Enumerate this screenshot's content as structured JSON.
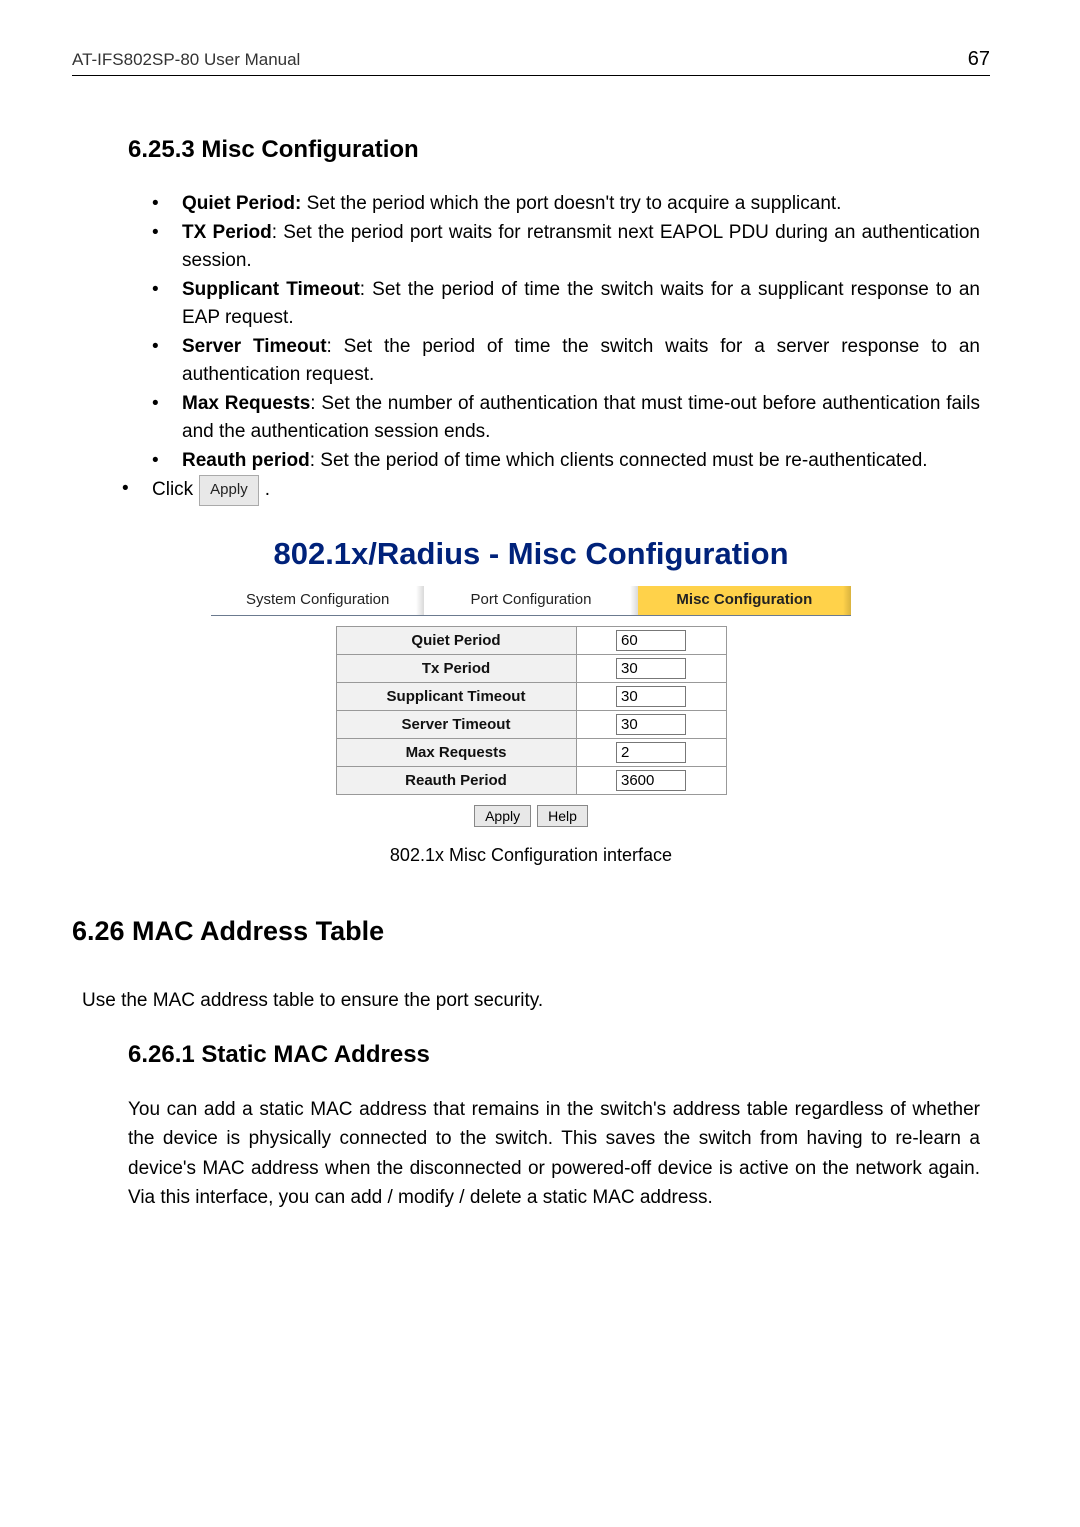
{
  "header": {
    "left": "AT-IFS802SP-80 User Manual",
    "right": "67"
  },
  "section_6_25_3": {
    "title": "6.25.3  Misc Configuration",
    "bullets": [
      {
        "bold": "Quiet Period:",
        "rest": " Set the period which the port doesn't try to acquire a supplicant."
      },
      {
        "bold": "TX Period",
        "rest": ": Set the period port waits for retransmit next EAPOL PDU during an authentication session."
      },
      {
        "bold": "Supplicant Timeout",
        "rest": ": Set the period of time the switch waits for a supplicant response to an EAP request."
      },
      {
        "bold": "Server Timeout",
        "rest": ": Set the period of time the switch waits for a server response to an authentication request."
      },
      {
        "bold": "Max Requests",
        "rest": ": Set the number of authentication that must time-out before authentication fails and the authentication session ends."
      },
      {
        "bold": "Reauth period",
        "rest": ": Set the period of time which clients connected must be re-authenticated."
      }
    ],
    "click_prefix": "Click",
    "click_button": "Apply",
    "click_suffix": "."
  },
  "screenshot": {
    "title": "802.1x/Radius - Misc Configuration",
    "tabs": [
      "System Configuration",
      "Port Configuration",
      "Misc Configuration"
    ],
    "active_tab": 2,
    "rows": [
      {
        "label": "Quiet Period",
        "value": "60"
      },
      {
        "label": "Tx Period",
        "value": "30"
      },
      {
        "label": "Supplicant Timeout",
        "value": "30"
      },
      {
        "label": "Server Timeout",
        "value": "30"
      },
      {
        "label": "Max Requests",
        "value": "2"
      },
      {
        "label": "Reauth Period",
        "value": "3600"
      }
    ],
    "buttons": {
      "apply": "Apply",
      "help": "Help"
    },
    "caption": "802.1x Misc Configuration interface"
  },
  "section_6_26": {
    "title": "6.26  MAC Address Table",
    "intro": "Use the MAC address table to ensure the port security."
  },
  "section_6_26_1": {
    "title": "6.26.1  Static MAC Address",
    "body": "You can add a static MAC address that remains in the switch's address table regardless of whether the device is physically connected to the switch. This saves the switch from having to re-learn a device's MAC address when the disconnected or powered-off device is active on the network again. Via this interface, you can add / modify / delete a static MAC address."
  }
}
